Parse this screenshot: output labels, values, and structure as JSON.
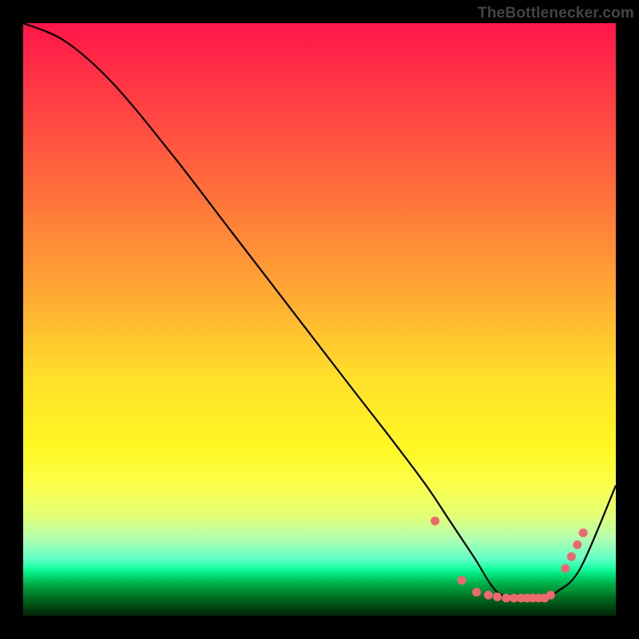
{
  "attribution": "TheBottlenecker.com",
  "chart_data": {
    "type": "line",
    "title": "",
    "xlabel": "",
    "ylabel": "",
    "xlim": [
      0,
      100
    ],
    "ylim": [
      0,
      100
    ],
    "series": [
      {
        "name": "curve",
        "x": [
          0,
          7,
          15,
          25,
          35,
          45,
          55,
          62,
          68,
          72,
          76,
          80,
          84,
          88,
          90,
          94,
          100
        ],
        "y": [
          100,
          97,
          90,
          78,
          65,
          52,
          39,
          30,
          22,
          16,
          10,
          4,
          3,
          3,
          4,
          8,
          22
        ]
      }
    ],
    "markers": {
      "name": "dots",
      "color": "#eb6a6f",
      "x": [
        69.5,
        74,
        76.5,
        78.5,
        80,
        81.5,
        82.8,
        84,
        85,
        86,
        87,
        88,
        89,
        91.5,
        92.5,
        93.5,
        94.5
      ],
      "y": [
        16,
        6,
        4,
        3.5,
        3.2,
        3.0,
        3.0,
        3.0,
        3.0,
        3.0,
        3.0,
        3.0,
        3.5,
        8,
        10,
        12,
        14
      ]
    }
  }
}
